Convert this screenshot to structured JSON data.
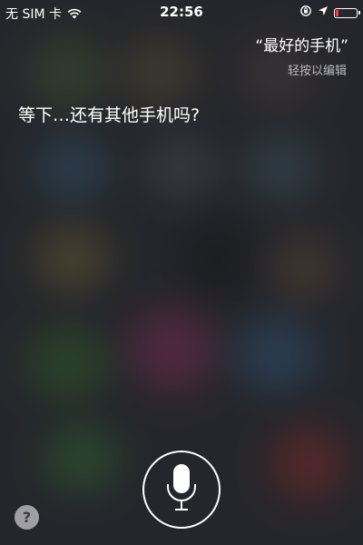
{
  "status_bar": {
    "carrier": "无 SIM 卡",
    "time": "22:56",
    "battery_level": 0.15,
    "icons": [
      "wifi-icon",
      "orientation-lock-icon",
      "location-arrow-icon",
      "battery-icon"
    ]
  },
  "conversation": {
    "user_query": "“最好的手机”",
    "edit_hint": "轻按以编辑",
    "siri_response": "等下…还有其他手机吗?"
  },
  "controls": {
    "help_label": "?",
    "mic_icon": "microphone-icon"
  },
  "colors": {
    "text": "#ffffff",
    "hint_text": "#b9bbc0",
    "battery_low": "#ff3b30"
  }
}
